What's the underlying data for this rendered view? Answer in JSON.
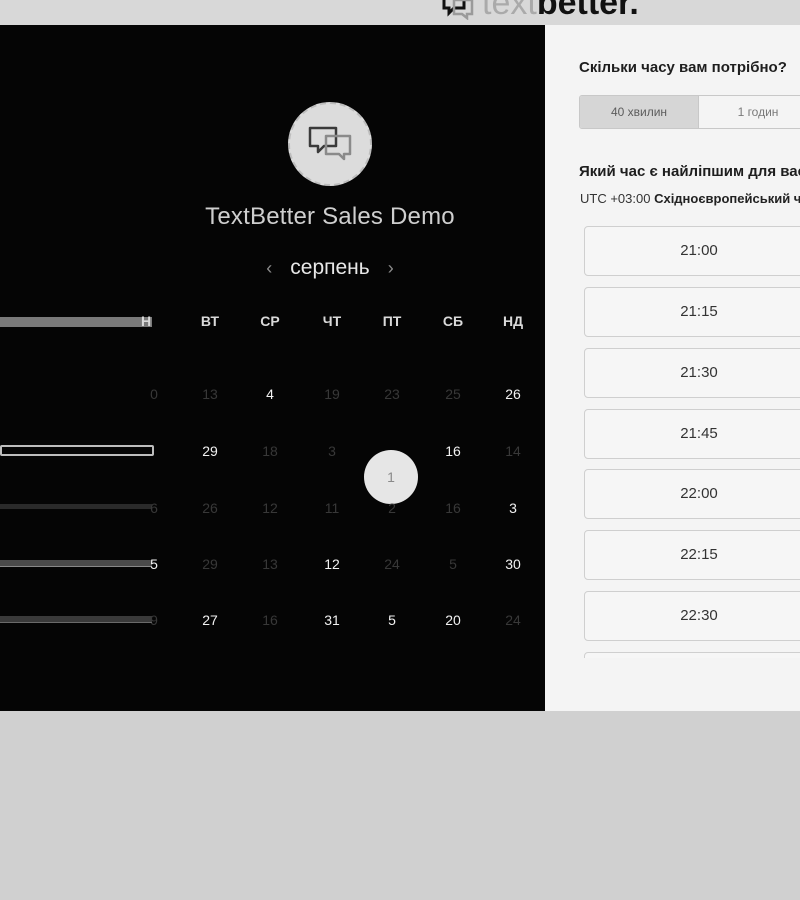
{
  "header": {
    "logo_text_light": "text",
    "logo_text_bold": "better."
  },
  "event": {
    "title": "TextBetter Sales Demo",
    "icon": "chat-bubbles-icon"
  },
  "calendar": {
    "month": "серпень",
    "prev_icon": "chevron-left-icon",
    "next_icon": "chevron-right-icon",
    "weekdays": [
      "Н",
      "ВТ",
      "СР",
      "ЧТ",
      "ПТ",
      "СБ",
      "НД"
    ],
    "rows": [
      [
        "0",
        "13",
        "4",
        "19",
        "23",
        "25",
        "26"
      ],
      [
        "",
        "29",
        "18",
        "3",
        "1",
        "16",
        "14"
      ],
      [
        "6",
        "26",
        "12",
        "11",
        "2",
        "16",
        "3"
      ],
      [
        "5",
        "29",
        "13",
        "12",
        "24",
        "5",
        "30"
      ],
      [
        "9",
        "27",
        "16",
        "31",
        "5",
        "20",
        "24"
      ]
    ],
    "selected_day": "1"
  },
  "booking": {
    "duration_question": "Скільки часу вам потрібно?",
    "duration_options": [
      "40 хвилин",
      "1 годин"
    ],
    "selected_duration": "40 хвилин",
    "time_question": "Який час є найліпшим для вас?",
    "timezone_offset": "UTC +03:00",
    "timezone_name": "Східноєвропейський час",
    "slots": [
      "21:00",
      "21:15",
      "21:30",
      "21:45",
      "22:00",
      "22:15",
      "22:30",
      ""
    ]
  },
  "colors": {
    "dark_panel": "#050505",
    "light_panel": "#f4f4f4",
    "page_bg": "#d0d0d0"
  }
}
